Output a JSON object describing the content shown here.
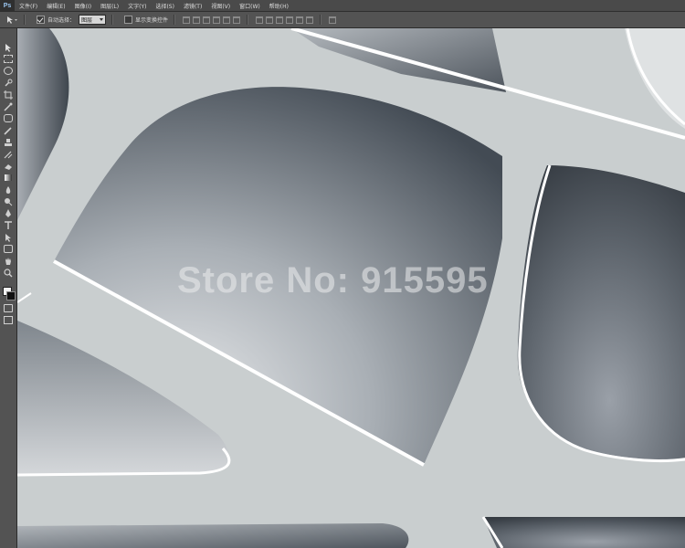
{
  "app": {
    "logo": "Ps",
    "menu": [
      "文件(F)",
      "编辑(E)",
      "图像(I)",
      "图层(L)",
      "文字(Y)",
      "选择(S)",
      "滤镜(T)",
      "视图(V)",
      "窗口(W)",
      "帮助(H)"
    ]
  },
  "options": {
    "auto_select_label": "自动选择：",
    "auto_select_value": "图层",
    "show_transform_label": "显示变换控件"
  },
  "tools": [
    "move-tool-icon",
    "marquee-tool-icon",
    "lasso-tool-icon",
    "quick-select-tool-icon",
    "crop-tool-icon",
    "eyedropper-tool-icon",
    "spot-heal-tool-icon",
    "brush-tool-icon",
    "clone-stamp-tool-icon",
    "history-brush-tool-icon",
    "eraser-tool-icon",
    "gradient-tool-icon",
    "blur-tool-icon",
    "dodge-tool-icon",
    "pen-tool-icon",
    "type-tool-icon",
    "path-select-tool-icon",
    "shape-tool-icon",
    "hand-tool-icon",
    "zoom-tool-icon"
  ],
  "canvas": {
    "watermark": "Store No: 915595",
    "colors": {
      "panel_light": "#c9cecf",
      "panel_dark": "#4b525a",
      "highlight": "#ffffff"
    }
  }
}
